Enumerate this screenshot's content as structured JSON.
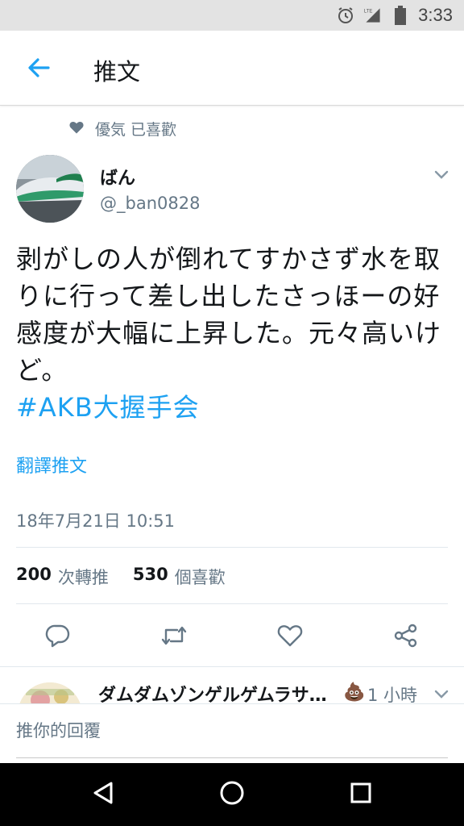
{
  "status_bar": {
    "time": "3:33",
    "network": "LTE",
    "icons": [
      "alarm-icon",
      "lte-signal-icon",
      "battery-icon"
    ]
  },
  "app_bar": {
    "title": "推文",
    "back_icon": "arrow-left-icon"
  },
  "social_context": {
    "icon": "heart-icon",
    "text": "優気 已喜歡"
  },
  "tweet": {
    "author_name": "ばん",
    "author_handle": "@_ban0828",
    "text": "剥がしの人が倒れてすかさず水を取りに行って差し出したさっほーの好感度が大幅に上昇した。元々高いけど。",
    "hashtag": "#AKB大握手会",
    "translate_label": "翻譯推文",
    "timestamp": "18年7月21日 10:51",
    "retweet_count": "200",
    "retweet_label": "次轉推",
    "like_count": "530",
    "like_label": "個喜歡"
  },
  "actions": [
    "reply-icon",
    "retweet-icon",
    "like-icon",
    "share-icon"
  ],
  "reply_preview": {
    "name": "ダムダムゾンゲルゲムラサ…",
    "emoji": "💩",
    "time": "1 小時"
  },
  "compose": {
    "placeholder": "推你的回覆"
  },
  "colors": {
    "accent": "#1da1f2",
    "secondary_text": "#657786",
    "primary_text": "#14171a"
  }
}
